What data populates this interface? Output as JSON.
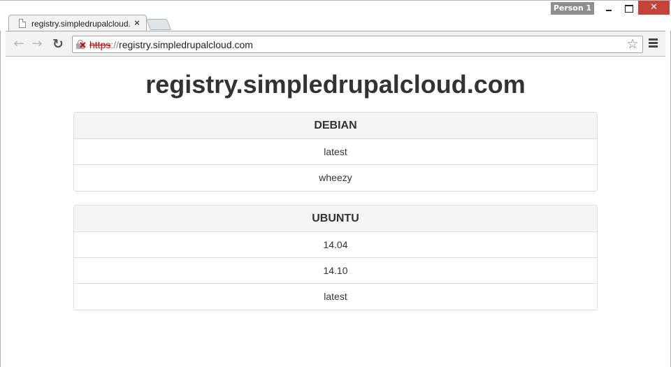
{
  "window": {
    "profile_label": "Person 1",
    "close_glyph": "✕"
  },
  "tab": {
    "title": "registry.simpledrupalcloud.com",
    "close_glyph": "×"
  },
  "toolbar": {
    "back_glyph": "←",
    "forward_glyph": "→",
    "reload_glyph": "↻",
    "url_scheme": "https",
    "url_sep": "://",
    "url_host": "registry.simpledrupalcloud.com",
    "star_glyph": "☆"
  },
  "page": {
    "title": "registry.simpledrupalcloud.com",
    "repositories": [
      {
        "name": "DEBIAN",
        "tags": [
          "latest",
          "wheezy"
        ]
      },
      {
        "name": "UBUNTU",
        "tags": [
          "14.04",
          "14.10",
          "latest"
        ]
      }
    ]
  },
  "colors": {
    "close_button": "#c7433a",
    "insecure_scheme": "#cc0000",
    "panel_heading_bg": "#f5f5f5",
    "panel_border": "#dddddd"
  }
}
